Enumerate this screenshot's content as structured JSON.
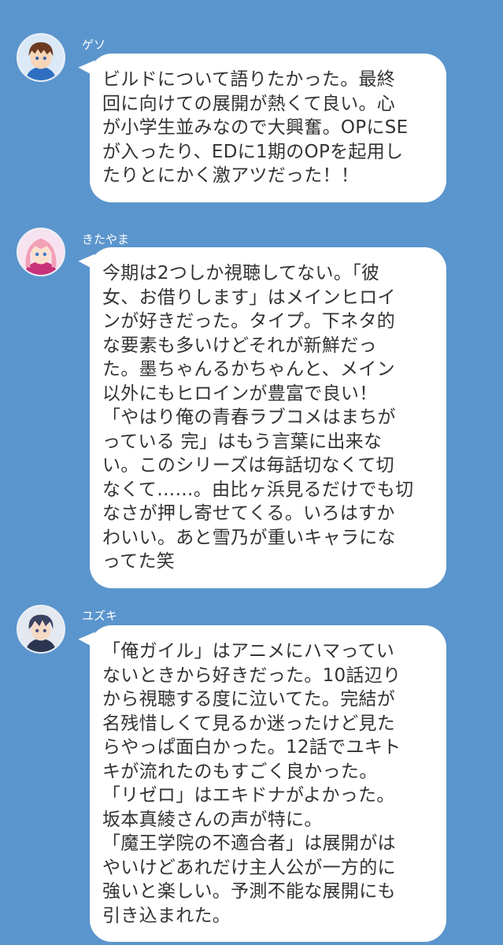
{
  "messages": [
    {
      "sender": "ゲソ",
      "avatar_icon": "boy-brown-hair-avatar-icon",
      "lines": [
        "ビルドについて語りたかった。最終",
        "回に向けての展開が熱くて良い。心",
        "が小学生並みなので大興奮。OPにSE",
        "が入ったり、EDに1期のOPを起用し",
        "たりとにかく激アツだった！！"
      ]
    },
    {
      "sender": "きたやま",
      "avatar_icon": "girl-pink-hair-avatar-icon",
      "lines": [
        "今期は2つしか視聴してない。「彼",
        "女、お借りします」はメインヒロイ",
        "ンが好きだった。タイプ。下ネタ的",
        "な要素も多いけどそれが新鮮だっ",
        "た。墨ちゃんるかちゃんと、メイン",
        "以外にもヒロインが豊富で良い！",
        "「やはり俺の青春ラブコメはまちが",
        "っている 完」はもう言葉に出来な",
        "い。このシリーズは毎話切なくて切",
        "なくて……。由比ヶ浜見るだけでも切",
        "なさが押し寄せてくる。いろはすか",
        "わいい。あと雪乃が重いキャラにな",
        "ってた笑"
      ]
    },
    {
      "sender": "ユズキ",
      "avatar_icon": "boy-dark-hair-avatar-icon",
      "lines": [
        "「俺ガイル」はアニメにハマってい",
        "ないときから好きだった。10話辺り",
        "から視聴する度に泣いてた。完結が",
        "名残惜しくて見るか迷ったけど見た",
        "らやっぱ面白かった。12話でユキト",
        "キが流れたのもすごく良かった。",
        "「リゼロ」はエキドナがよかった。",
        "坂本真綾さんの声が特に。",
        "「魔王学院の不適合者」は展開がは",
        "やいけどあれだけ主人公が一方的に",
        "強いと楽しい。予測不能な展開にも",
        "引き込まれた。"
      ]
    }
  ],
  "colors": {
    "background": "#5b95cd",
    "bubble": "#ffffff",
    "text": "#333333",
    "name": "#ffffff"
  }
}
